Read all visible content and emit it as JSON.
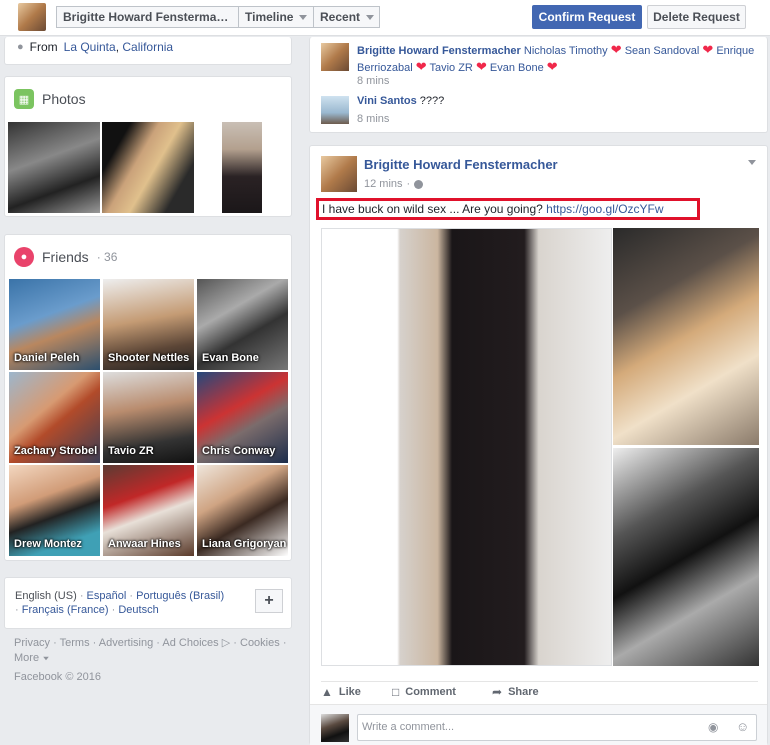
{
  "topbar": {
    "profile_name": "Brigitte Howard Fenstermacher",
    "timeline_label": "Timeline",
    "recent_label": "Recent",
    "confirm_label": "Confirm Request",
    "delete_label": "Delete Request"
  },
  "intro": {
    "from_prefix": "From",
    "city": "La Quinta",
    "state": "California",
    "separator": ","
  },
  "photos": {
    "title": "Photos"
  },
  "friends": {
    "title": "Friends",
    "sep": "·",
    "count": "36",
    "items": [
      {
        "name": "Daniel Peleh"
      },
      {
        "name": "Shooter Nettles"
      },
      {
        "name": "Evan Bone"
      },
      {
        "name": "Zachary Strobel"
      },
      {
        "name": "Tavio ZR"
      },
      {
        "name": "Chris Conway"
      },
      {
        "name": "Drew Montez"
      },
      {
        "name": "Anwaar Hines"
      },
      {
        "name": "Liana Grigoryan"
      }
    ]
  },
  "languages": {
    "sep": "·",
    "items": [
      "English (US)",
      "Español",
      "Português (Brasil)",
      "Français (France)",
      "Deutsch"
    ],
    "add_label": "+"
  },
  "footer": {
    "links": [
      "Privacy",
      "Terms",
      "Advertising",
      "Ad Choices",
      "Cookies",
      "More"
    ],
    "sep": "·",
    "copyright": "Facebook © 2016"
  },
  "comments": {
    "c1": {
      "author": "Brigitte Howard Fenstermacher",
      "tags": [
        "Nicholas Timothy",
        "Sean Sandoval",
        "Enrique Berriozabal",
        "Tavio ZR",
        "Evan Bone"
      ],
      "time": "8 mins"
    },
    "c2": {
      "author": "Vini Santos",
      "text": "????",
      "time": "8 mins"
    }
  },
  "post": {
    "author": "Brigitte Howard Fenstermacher",
    "time": "12 mins",
    "dot": "·",
    "text": "I have buck on wild sex ... Are you going?",
    "link": "https://goo.gl/OzcYFw",
    "actions": {
      "like": "Like",
      "comment": "Comment",
      "share": "Share"
    },
    "comment_placeholder": "Write a comment..."
  },
  "colors": {
    "brand": "#4267b2",
    "link": "#365899",
    "highlight": "#e0112b",
    "heart": "#f0284a"
  }
}
